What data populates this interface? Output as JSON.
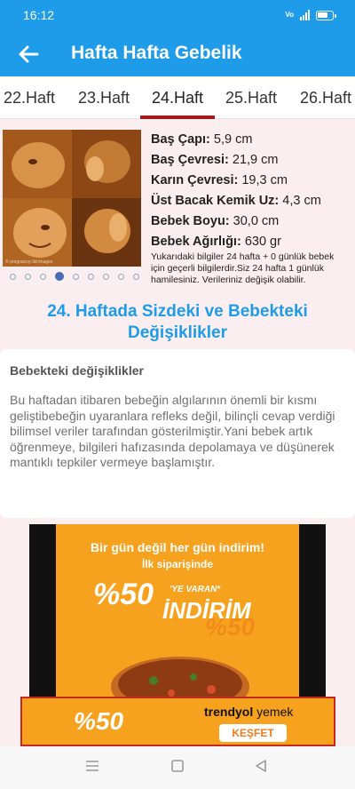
{
  "status": {
    "time": "16:12",
    "volte": "Vo",
    "network": "4G"
  },
  "appbar": {
    "title": "Hafta Hafta Gebelik",
    "back_icon": "arrow-left-icon"
  },
  "tabs": [
    {
      "label": "22.Haft"
    },
    {
      "label": "23.Haft"
    },
    {
      "label": "24.Haft",
      "active": true
    },
    {
      "label": "25.Haft"
    },
    {
      "label": "26.Haft"
    }
  ],
  "photo": {
    "watermark": "© pregnancy-3d-images",
    "dots_total": 9,
    "dots_active_index": 3
  },
  "info": [
    {
      "label": "Baş Çapı:",
      "value": "5,9 cm"
    },
    {
      "label": "Baş Çevresi:",
      "value": "21,9 cm"
    },
    {
      "label": "Karın Çevresi:",
      "value": "19,3 cm"
    },
    {
      "label": "Üst Bacak Kemik Uz:",
      "value": "4,3 cm"
    },
    {
      "label": "Bebek Boyu:",
      "value": "30,0 cm"
    },
    {
      "label": "Bebek Ağırlığı:",
      "value": "630 gr"
    }
  ],
  "note": "Yukarıdaki bilgiler 24 hafta + 0 günlük bebek için geçerli bilgilerdir.Siz 24 hafta 1 günlük hamilesiniz. Verileriniz değişik olabilir.",
  "headline": {
    "line1": "24. Haftada Sizdeki ve Bebekteki",
    "line2": "Değişiklikler"
  },
  "card": {
    "title": "Bebekteki değişiklikler",
    "body": "Bu haftadan itibaren bebeğin algılarının önemli bir kısmı geliştibebeğin uyaranlara refleks değil, bilinçli cevap verdiği bilimsel veriler tarafından gösterilmiştir.Yani bebek artık öğrenmeye, bilgileri hafızasında depolamaya ve düşünerek mantıklı tepkiler vermeye başlamıştır."
  },
  "ad": {
    "headline": "Bir gün değil her gün indirim!",
    "subline": "İlk siparişinde",
    "percent": "%50",
    "small": "'YE VARAN*",
    "word": "İNDİRİM",
    "percent2": "%50",
    "brand_main": "trendyol",
    "brand_sub": "yemek",
    "cta": "KEŞFET",
    "banner_percent": "%50",
    "colors": {
      "bg": "#f7a21f",
      "frame": "#c7281f",
      "brand": "#f27a1a"
    }
  },
  "navbar": {
    "icons": [
      "menu-icon",
      "home-square-icon",
      "back-triangle-icon"
    ]
  }
}
